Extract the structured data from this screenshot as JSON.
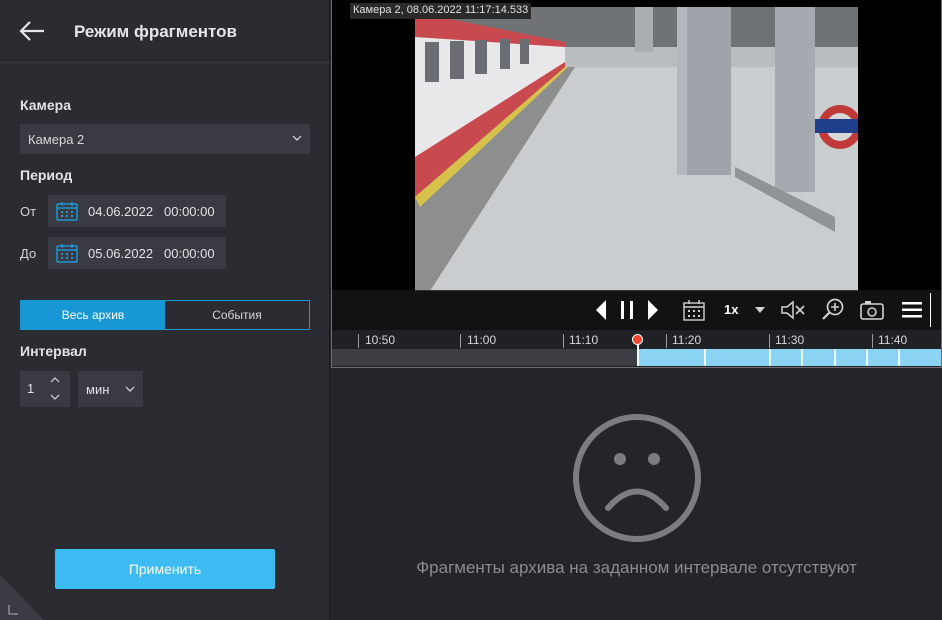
{
  "header": {
    "title": "Режим фрагментов",
    "back_icon": "arrow-left-icon"
  },
  "camera": {
    "label": "Камера",
    "selected": "Камера 2"
  },
  "period": {
    "label": "Период",
    "from_label": "От",
    "from_date": "04.06.2022",
    "from_time": "00:00:00",
    "to_label": "До",
    "to_date": "05.06.2022",
    "to_time": "00:00:00"
  },
  "mode_tabs": {
    "active": "Весь архив",
    "inactive": "События"
  },
  "interval": {
    "label": "Интервал",
    "value": "1",
    "unit": "мин"
  },
  "apply_label": "Применить",
  "video": {
    "caption": "Камера 2, 08.06.2022 11:17:14.533",
    "speed": "1x",
    "controls": [
      "prev-frame-icon",
      "pause-icon",
      "next-frame-icon",
      "calendar-icon",
      "speed-dropdown",
      "mute-icon",
      "zoom-icon",
      "snapshot-icon",
      "menu-icon"
    ]
  },
  "timeline": {
    "labels": [
      "10:50",
      "11:00",
      "11:10",
      "11:20",
      "11:30",
      "11:40"
    ]
  },
  "empty_state": {
    "icon": "sad-face-icon",
    "message": "Фрагменты архива на заданном интервале отсутствуют"
  },
  "colors": {
    "accent": "#1797d4",
    "apply": "#3dbcf4",
    "archive_fill": "#8bd3f3",
    "cursor": "#ee4433"
  }
}
